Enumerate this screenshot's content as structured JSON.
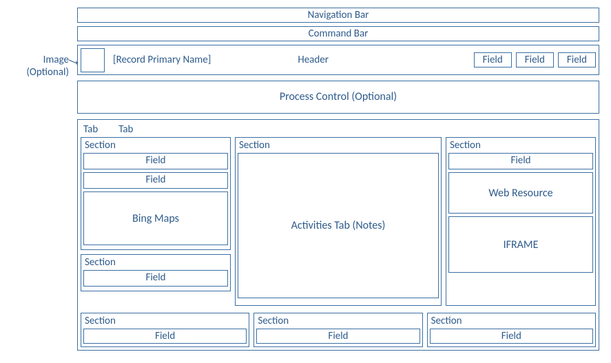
{
  "annotation": {
    "image": "Image",
    "optional": "(Optional)"
  },
  "nav_bar": "Navigation Bar",
  "cmd_bar": "Command Bar",
  "header": {
    "primary_name": "[Record Primary Name]",
    "title": "Header",
    "fields": [
      "Field",
      "Field",
      "Field"
    ]
  },
  "process": "Process Control (Optional)",
  "tabs": [
    "Tab",
    "Tab"
  ],
  "left": {
    "section1": {
      "label": "Section",
      "field1": "Field",
      "field2": "Field",
      "bing": "Bing Maps"
    },
    "section2": {
      "label": "Section",
      "field1": "Field"
    }
  },
  "mid": {
    "section1": {
      "label": "Section",
      "activities": "Activities Tab (Notes)"
    }
  },
  "right": {
    "section1": {
      "label": "Section",
      "field1": "Field",
      "wr": "Web Resource",
      "iframe": "IFRAME"
    }
  },
  "row2": {
    "s1": {
      "label": "Section",
      "field": "Field"
    },
    "s2": {
      "label": "Section",
      "field": "Field"
    },
    "s3": {
      "label": "Section",
      "field": "Field"
    }
  }
}
